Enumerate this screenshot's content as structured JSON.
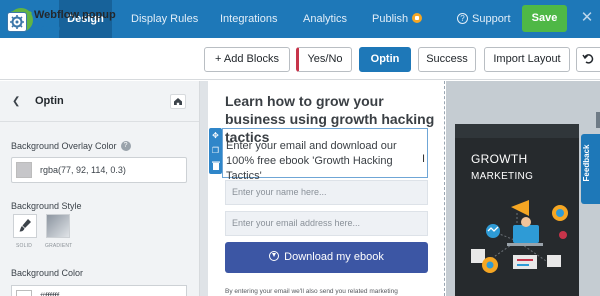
{
  "nav": {
    "tabs": [
      {
        "label": "Design",
        "active": true
      },
      {
        "label": "Display Rules"
      },
      {
        "label": "Integrations"
      },
      {
        "label": "Analytics"
      },
      {
        "label": "Publish"
      }
    ],
    "support_label": "Support",
    "save_label": "Save",
    "close_label": "✕"
  },
  "header": {
    "popup_title": "Webflow popup",
    "popup_type": "Popup",
    "buttons": {
      "add_blocks": "+ Add Blocks",
      "yes_no": "Yes/No",
      "optin": "Optin",
      "success": "Success",
      "import_layout": "Import Layout"
    }
  },
  "sidebar": {
    "title": "Optin",
    "overlay_label": "Background Overlay Color",
    "overlay_value": "rgba(77, 92, 114, 0.3)",
    "style_label": "Background Style",
    "style_solid": "SOLID",
    "style_gradient": "GRADIENT",
    "bg_color_label": "Background Color",
    "bg_color_value": "#ffffff"
  },
  "canvas": {
    "headline": "Learn how to grow your business using growth hacking tactics",
    "description": "Enter your email and download our 100% free ebook 'Growth Hacking Tactics'",
    "name_placeholder": "Enter your name here...",
    "email_placeholder": "Enter your email address here...",
    "button_label": "Download my ebook",
    "disclaimer": "By entering your email we'll also send you related marketing"
  },
  "book": {
    "title_line1": "GROWTH",
    "title_line2": "MARKETING"
  },
  "feedback_label": "Feedback",
  "colors": {
    "nav_bg": "#1e78b8",
    "nav_active": "#17629a",
    "save_green": "#4fb846",
    "primary_blue": "#1e78b8",
    "download_button": "#3c56a4",
    "yes_no_accent": "#c7344a"
  }
}
